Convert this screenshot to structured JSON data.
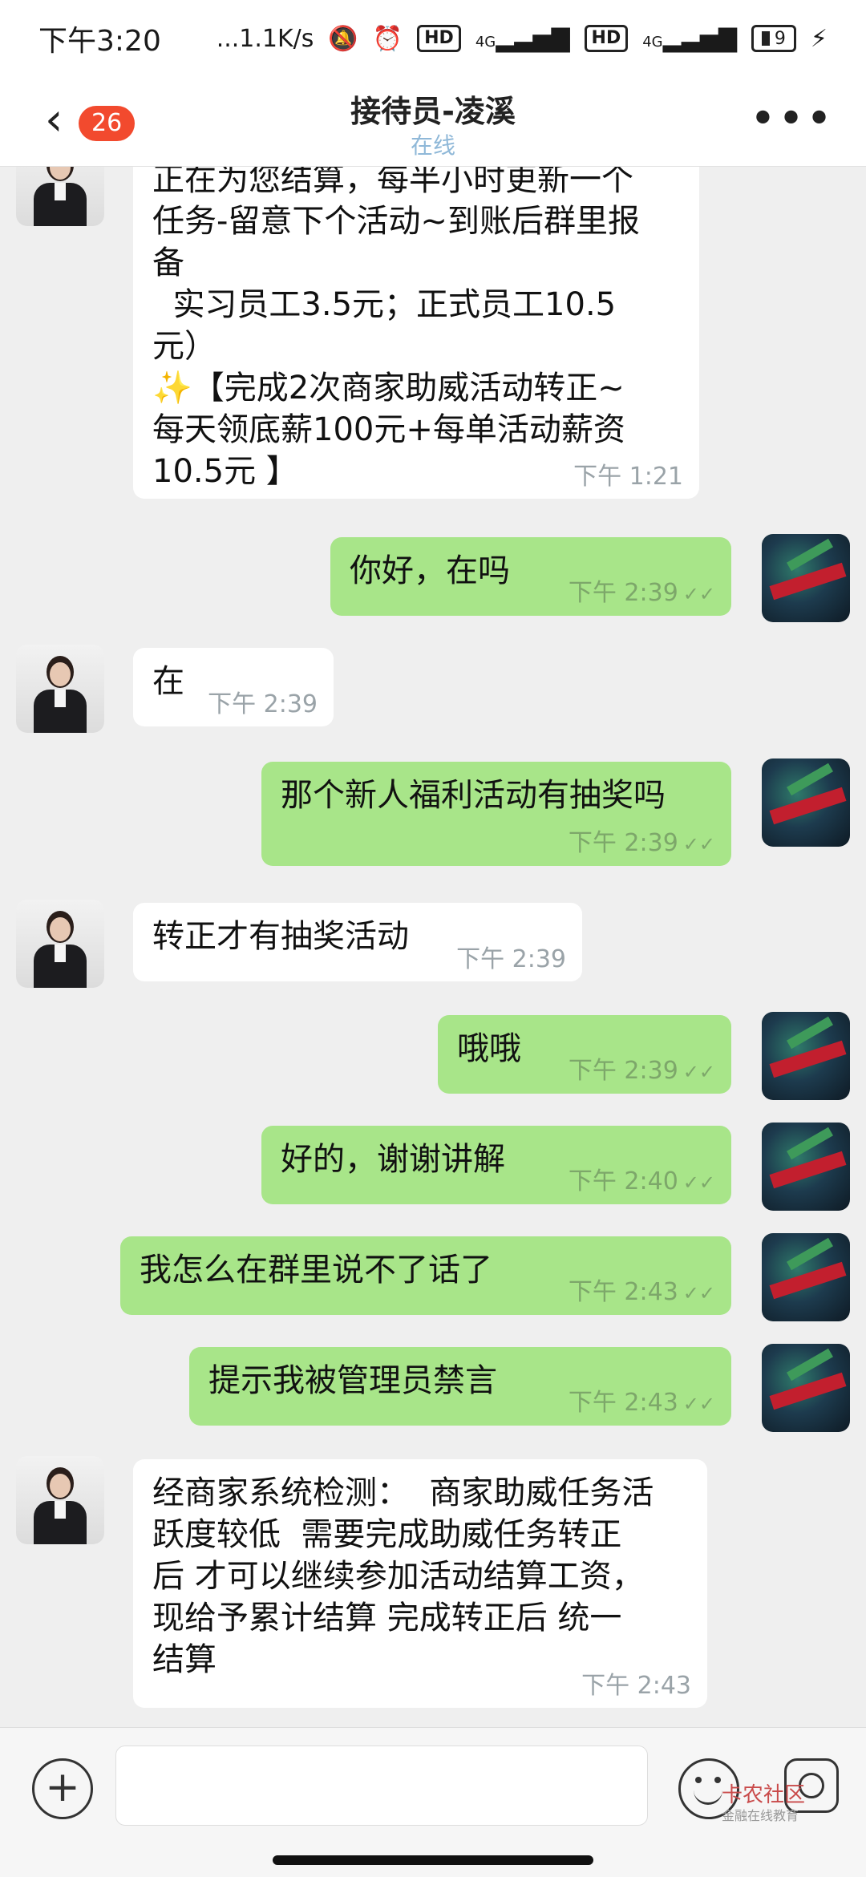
{
  "status_bar": {
    "time": "下午3:20",
    "network_speed": "...1.1K/s",
    "hd1": "HD",
    "signal1": "4G",
    "hd2": "HD",
    "signal2": "4G",
    "battery": "9",
    "icons": [
      "mute-icon",
      "alarm-icon",
      "signal-icon",
      "charging-icon"
    ]
  },
  "header": {
    "back_icon": "chevron-left-icon",
    "unread_count": "26",
    "title": "接待员-凌溪",
    "status": "在线",
    "more_icon": "more-icon"
  },
  "messages": [
    {
      "side": "in",
      "text": "正在为您结算，每半小时更新一个\n任务-留意下个活动~到账后群里报\n备\n  实习员工3.5元；正式员工10.5\n元）\n✨【完成2次商家助威活动转正~\n每天领底薪100元+每单活动薪资\n10.5元 】",
      "time": "下午 1:21"
    },
    {
      "side": "out",
      "text": "你好，在吗",
      "time": "下午 2:39",
      "ticks": "✓✓"
    },
    {
      "side": "in",
      "text": "在",
      "time": "下午 2:39"
    },
    {
      "side": "out",
      "text": "那个新人福利活动有抽奖吗",
      "time": "下午 2:39",
      "ticks": "✓✓"
    },
    {
      "side": "in",
      "text": "转正才有抽奖活动",
      "time": "下午 2:39"
    },
    {
      "side": "out",
      "text": "哦哦",
      "time": "下午 2:39",
      "ticks": "✓✓"
    },
    {
      "side": "out",
      "text": "好的，谢谢讲解",
      "time": "下午 2:40",
      "ticks": "✓✓"
    },
    {
      "side": "out",
      "text": "我怎么在群里说不了话了",
      "time": "下午 2:43",
      "ticks": "✓✓"
    },
    {
      "side": "out",
      "text": "提示我被管理员禁言",
      "time": "下午 2:43",
      "ticks": "✓✓"
    },
    {
      "side": "in",
      "text": "经商家系统检测：  商家助威任务活\n跃度较低  需要完成助威任务转正\n后 才可以继续参加活动结算工资，\n现给予累计结算 完成转正后 统一\n结算",
      "time": "下午 2:43"
    }
  ],
  "input_bar": {
    "placeholder": "",
    "add_icon": "plus-circle-icon",
    "emoji_icon": "smiley-icon",
    "camera_icon": "camera-icon"
  },
  "watermark": {
    "name": "卡农社区",
    "tagline": "金融在线教育"
  }
}
